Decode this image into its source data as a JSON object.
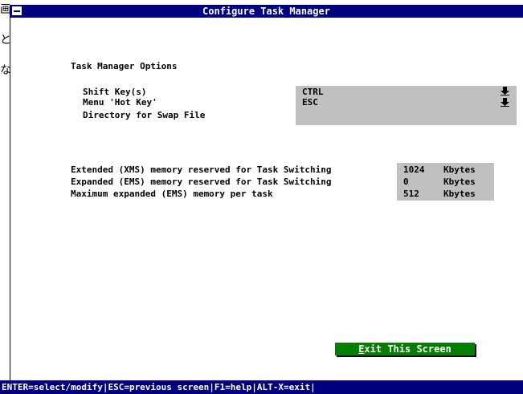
{
  "side_glyphs": [
    "画",
    "と",
    "な"
  ],
  "window": {
    "title": "Configure Task Manager"
  },
  "options": {
    "heading": "Task Manager Options",
    "labels": [
      "Shift Key(s)",
      "Menu 'Hot Key'",
      "Directory for Swap File"
    ],
    "values": {
      "shift_key": "CTRL",
      "hot_key": "ESC",
      "swap_dir": ""
    },
    "dropdown_icons": [
      "down-arrow-icon",
      "down-arrow-icon"
    ]
  },
  "memory": {
    "rows": [
      {
        "label": "Extended (XMS) memory reserved for Task Switching",
        "value": "1024",
        "unit": "Kbytes"
      },
      {
        "label": "Expanded (EMS) memory reserved for Task Switching",
        "value": "0",
        "unit": "Kbytes"
      },
      {
        "label": "Maximum expanded (EMS) memory per task",
        "value": "512",
        "unit": "Kbytes"
      }
    ]
  },
  "exit_button": {
    "hotkey": "E",
    "rest": "xit This Screen"
  },
  "statusbar": {
    "text": "ENTER=select/modify|ESC=previous screen|F1=help|ALT-X=exit|"
  },
  "colors": {
    "title_bar": "#00007f",
    "status_bar": "#00007f",
    "field_bg": "#c0c0c0",
    "button_bg": "#007f00"
  }
}
